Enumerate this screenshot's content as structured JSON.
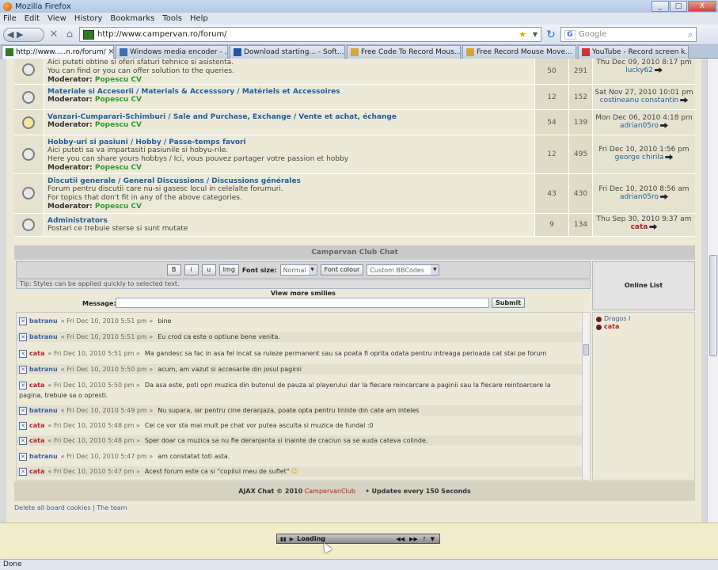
{
  "window": {
    "title": "Mozilla Firefox",
    "min": "_",
    "max": "□",
    "close": "X"
  },
  "menu": [
    "File",
    "Edit",
    "View",
    "History",
    "Bookmarks",
    "Tools",
    "Help"
  ],
  "nav": {
    "url": "http://www.campervan.ro/forum/",
    "search_placeholder": "Google"
  },
  "tabs": [
    {
      "label": "http://www.....n.ro/forum/",
      "color": "#2f7a25"
    },
    {
      "label": "Windows media encoder - ...",
      "color": "#3a6fb5"
    },
    {
      "label": "Download starting... - Soft...",
      "color": "#2454a6"
    },
    {
      "label": "Free Code To Record Mous...",
      "color": "#d7a63a"
    },
    {
      "label": "Free Record Mouse Move...",
      "color": "#d7a63a"
    },
    {
      "label": "YouTube - Record screen k...",
      "color": "#d32f2f"
    }
  ],
  "forums": [
    {
      "title": "",
      "desc": [
        "Aici puteti obtine si oferi sfaturi tehnice si asistenta.",
        "You can find or you can offer solution to the queries."
      ],
      "moderator_label": "Moderator:",
      "moderator": "Popescu CV",
      "topics": "50",
      "posts": "291",
      "last_date": "Thu Dec 09, 2010 8:17 pm",
      "last_user": "lucky62",
      "last_red": false
    },
    {
      "title": "Materiale si Accesorii / Materials & Accesssory / Matériels et Accessoires",
      "desc": [],
      "moderator_label": "Moderator:",
      "moderator": "Popescu CV",
      "topics": "12",
      "posts": "152",
      "last_date": "Sat Nov 27, 2010 10:01 pm",
      "last_user": "costineanu constantin",
      "last_red": false
    },
    {
      "title": "Vanzari-Cumparari-Schimburi / Sale and Purchase, Exchange / Vente et achat, échange",
      "desc": [],
      "moderator_label": "Moderator:",
      "moderator": "Popescu CV",
      "topics": "54",
      "posts": "139",
      "last_date": "Mon Dec 06, 2010 4:18 pm",
      "last_user": "adrian05ro",
      "last_red": false
    },
    {
      "title": "Hobby-uri si pasiuni / Hobby / Passe-temps favori",
      "desc": [
        "Aici puteti sa va impartasiti pasiunile si hobyu-rile.",
        "Here you can share yours hobbys / Ici, vous pouvez partager votre passion et hobby"
      ],
      "moderator_label": "Moderator:",
      "moderator": "Popescu CV",
      "topics": "12",
      "posts": "495",
      "last_date": "Fri Dec 10, 2010 1:56 pm",
      "last_user": "george chirila",
      "last_red": false
    },
    {
      "title": "Discutii generale / General Discussions / Discussions générales",
      "desc": [
        "Forum pentru discutii care nu-si gasesc locul in celelalte forumuri.",
        "For topics that don't fit in any of the above categories."
      ],
      "moderator_label": "Moderator:",
      "moderator": "Popescu CV",
      "topics": "43",
      "posts": "430",
      "last_date": "Fri Dec 10, 2010 8:56 am",
      "last_user": "adrian05ro",
      "last_red": false
    },
    {
      "title": "Administrators",
      "desc": [
        "Postari ce trebuie sterse si sunt mutate"
      ],
      "moderator_label": "",
      "moderator": "",
      "topics": "9",
      "posts": "134",
      "last_date": "Thu Sep 30, 2010 9:37 am",
      "last_user": "cata",
      "last_red": true
    }
  ],
  "chat": {
    "header": "Campervan Club Chat",
    "buttons": {
      "bold": "B",
      "italic": "i",
      "underline": "u",
      "img": "Img",
      "font_size_label": "Font size:",
      "font_size_value": "Normal",
      "font_colour": "Font colour",
      "bbcodes": "Custom BBCodes"
    },
    "tip": "Tip: Styles can be applied quickly to selected text.",
    "more_smilies": "View more smilies",
    "message_label": "Message:",
    "submit": "Submit",
    "online_header": "Online List",
    "online": [
      {
        "name": "Dragos I",
        "red": false
      },
      {
        "name": "cata",
        "red": true
      }
    ],
    "messages": [
      {
        "user": "batranu",
        "time": "« Fri Dec 10, 2010 5:51 pm »",
        "text": "bine"
      },
      {
        "user": "batranu",
        "time": "« Fri Dec 10, 2010 5:51 pm »",
        "text": "Eu crod ca este o optiune bene venita."
      },
      {
        "user": "cata",
        "time": "« Fri Dec 10, 2010 5:51 pm »",
        "text": "Ma gandesc sa fac in asa fel incat sa ruleze permanent sau sa poata fi oprita odata pentru intreaga perioada cat stai pe forum"
      },
      {
        "user": "batranu",
        "time": "« Fri Dec 10, 2010 5:50 pm »",
        "text": "acum, am vazut si accesarile din josul paginii"
      },
      {
        "user": "cata",
        "time": "« Fri Dec 10, 2010 5:50 pm »",
        "text": "Da asa este, poti opri muzica din butonul de pauza al playerului dar la fiecare reincarcare a paginii sau la fiecare reintoarcere la",
        "text2": "pagina, trebuie sa o opresti."
      },
      {
        "user": "batranu",
        "time": "« Fri Dec 10, 2010 5:49 pm »",
        "text": "Nu supara, iar pentru cine deranjaza, poate opta pentru liniste din cate am inteles"
      },
      {
        "user": "cata",
        "time": "« Fri Dec 10, 2010 5:48 pm »",
        "text": "Cei ce vor sta mai mult pe chat vor putea asculta si muzica de fundal :0"
      },
      {
        "user": "cata",
        "time": "« Fri Dec 10, 2010 5:48 pm »",
        "text": "Sper doar ca muzica sa nu fie deranjanta si inainte de craciun sa se auda cateva colinde."
      },
      {
        "user": "batranu",
        "time": "« Fri Dec 10, 2010 5:47 pm »",
        "text": "am constatat toti asta."
      },
      {
        "user": "cata",
        "time": "« Fri Dec 10, 2010 5:47 pm »",
        "text": "Acest forum este ca si \"copilul meu de suflet\""
      }
    ],
    "footer_prefix": "AJAX Chat © 2010",
    "footer_brand": "CampervanClub",
    "footer_updates": "• Updates every 150 Seconds"
  },
  "bottom_links": "Delete all board cookies | The team",
  "player": {
    "status": "Loading",
    "q": "?"
  },
  "status": "Done"
}
